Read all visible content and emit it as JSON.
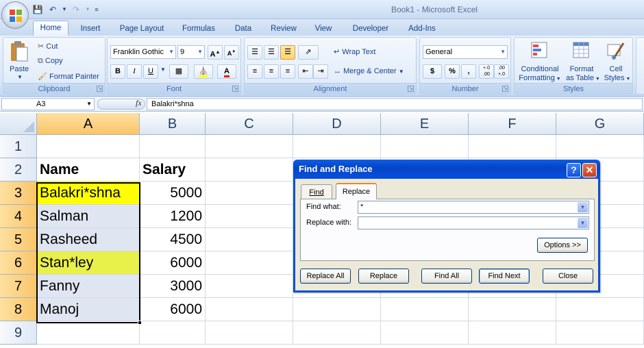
{
  "window": {
    "title": "Book1 - Microsoft Excel"
  },
  "tabs": [
    "Home",
    "Insert",
    "Page Layout",
    "Formulas",
    "Data",
    "Review",
    "View",
    "Developer",
    "Add-Ins"
  ],
  "ribbon": {
    "clipboard": {
      "label": "Clipboard",
      "paste": "Paste",
      "cut": "Cut",
      "copy": "Copy",
      "format_painter": "Format Painter"
    },
    "font": {
      "label": "Font",
      "name": "Franklin Gothic",
      "size": "9",
      "bold": "B",
      "italic": "I",
      "underline": "U",
      "grow": "A",
      "shrink": "A",
      "color_letter": "A"
    },
    "alignment": {
      "label": "Alignment",
      "wrap_text": "Wrap Text",
      "merge_center": "Merge & Center"
    },
    "number": {
      "label": "Number",
      "format": "General",
      "currency": "$",
      "percent": "%",
      "comma": ",",
      "inc_dec": "+.0 .00",
      "dec_dec": ".00 +.0"
    },
    "styles": {
      "label": "Styles",
      "conditional": [
        "Conditional",
        "Formatting"
      ],
      "format_table": [
        "Format",
        "as Table"
      ],
      "cell_styles": [
        "Cell",
        "Styles"
      ]
    }
  },
  "formula_bar": {
    "name_box": "A3",
    "fx": "fx",
    "content": "Balakri*shna"
  },
  "sheet": {
    "columns": [
      "A",
      "B",
      "C",
      "D",
      "E",
      "F",
      "G"
    ],
    "rows": [
      "1",
      "2",
      "3",
      "4",
      "5",
      "6",
      "7",
      "8",
      "9"
    ],
    "header": {
      "name": "Name",
      "salary": "Salary"
    },
    "data": [
      {
        "name": "Balakri*shna",
        "salary": "5000",
        "highlight": "#ffff00"
      },
      {
        "name": "Salman",
        "salary": "1200",
        "highlight": ""
      },
      {
        "name": "Rasheed",
        "salary": "4500",
        "highlight": ""
      },
      {
        "name": "Stan*ley",
        "salary": "6000",
        "highlight": "#e8f04a"
      },
      {
        "name": "Fanny",
        "salary": "3000",
        "highlight": ""
      },
      {
        "name": "Manoj",
        "salary": "6000",
        "highlight": ""
      }
    ]
  },
  "dialog": {
    "title": "Find and Replace",
    "help": "?",
    "close": "✕",
    "tabs": [
      "Find",
      "Replace"
    ],
    "find_label": "Find what:",
    "find_value": "*",
    "replace_label": "Replace with:",
    "replace_value": "",
    "options": "Options >>",
    "buttons": [
      "Replace All",
      "Replace",
      "Find All",
      "Find Next",
      "Close"
    ]
  }
}
